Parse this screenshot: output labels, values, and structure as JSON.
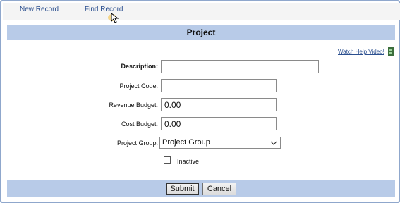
{
  "toolbar": {
    "new_record": "New Record",
    "find_record": "Find Record"
  },
  "title": "Project",
  "help": {
    "label": "Watch Help Video!"
  },
  "form": {
    "description": {
      "label": "Description:",
      "value": ""
    },
    "project_code": {
      "label": "Project Code:",
      "value": ""
    },
    "revenue_budget": {
      "label": "Revenue Budget:",
      "value": "0.00"
    },
    "cost_budget": {
      "label": "Cost Budget:",
      "value": "0.00"
    },
    "project_group": {
      "label": "Project Group:",
      "selected": "Project Group"
    },
    "inactive": {
      "label": "Inactive",
      "checked": false
    }
  },
  "buttons": {
    "submit_first": "S",
    "submit_rest": "ubmit",
    "cancel": "Cancel"
  },
  "colors": {
    "bar": "#b8cbe8",
    "link": "#2b4f8f",
    "frame": "#8fa7cc"
  }
}
